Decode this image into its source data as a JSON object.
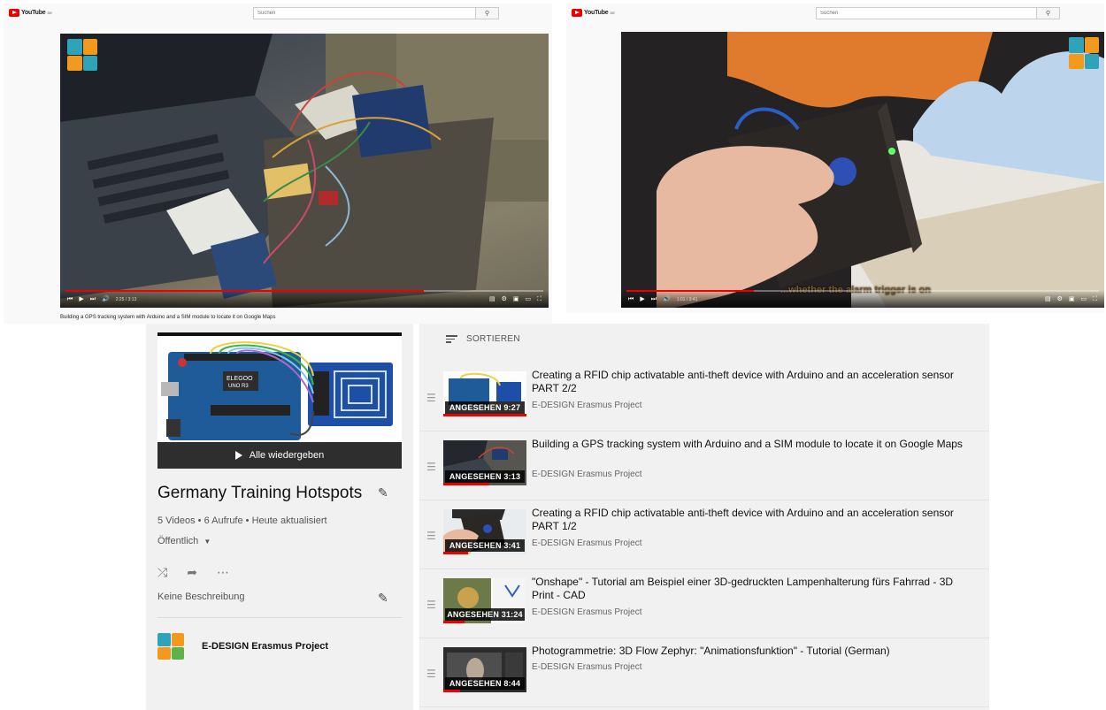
{
  "top_left": {
    "logo": "YouTube",
    "logo_suffix": "DE",
    "search_placeholder": "Suchen",
    "search_icon": "search-icon",
    "time": "2:25 / 3:13",
    "progress": 0.75,
    "caption": "Building a GPS tracking system with Arduino and a SIM module to locate it on Google Maps"
  },
  "top_right": {
    "logo": "YouTube",
    "logo_suffix": "DE",
    "search_placeholder": "Suchen",
    "search_icon": "search-icon",
    "time": "1:01 / 3:41",
    "progress": 0.27,
    "subtitle": "...whether the alarm trigger is on"
  },
  "playlist": {
    "play_all": "Alle wiedergeben",
    "title": "Germany Training Hotspots",
    "meta": "5 Videos • 6 Aufrufe • Heute aktualisiert",
    "privacy": "Öffentlich",
    "description": "Keine Beschreibung",
    "owner": "E-DESIGN Erasmus Project",
    "board_label_1": "ELEGOO",
    "board_label_2": "UNO R3"
  },
  "list": {
    "sort_label": "SORTIEREN",
    "items": [
      {
        "title": "Creating a RFID chip activatable anti-theft device with Arduino and an acceleration sensor PART 2/2",
        "channel": "E-DESIGN Erasmus Project",
        "badge": "ANGESEHEN 9:27",
        "watched": 1.0
      },
      {
        "title": "Building a GPS tracking system with Arduino and a SIM module to locate it on Google Maps",
        "channel": "E-DESIGN Erasmus Project",
        "badge": "ANGESEHEN 3:13",
        "watched": 0.55
      },
      {
        "title": "Creating a RFID chip activatable anti-theft device with Arduino and an acceleration sensor PART 1/2",
        "channel": "E-DESIGN Erasmus Project",
        "badge": "ANGESEHEN 3:41",
        "watched": 0.3
      },
      {
        "title": "\"Onshape\" - Tutorial am Beispiel einer 3D-gedruckten Lampenhalterung fürs Fahrrad - 3D Print - CAD",
        "channel": "E-DESIGN Erasmus Project",
        "badge": "ANGESEHEN 31:24",
        "watched": 0.25
      },
      {
        "title": "Photogrammetrie: 3D Flow Zephyr: \"Animationsfunktion\" - Tutorial (German)",
        "channel": "E-DESIGN Erasmus Project",
        "badge": "ANGESEHEN 8:44",
        "watched": 0.2
      }
    ]
  },
  "colors": {
    "youtube_red": "#e00000",
    "logo_orange": "#f39a1e",
    "logo_teal": "#2fa3b7",
    "logo_green": "#5fb24a"
  }
}
